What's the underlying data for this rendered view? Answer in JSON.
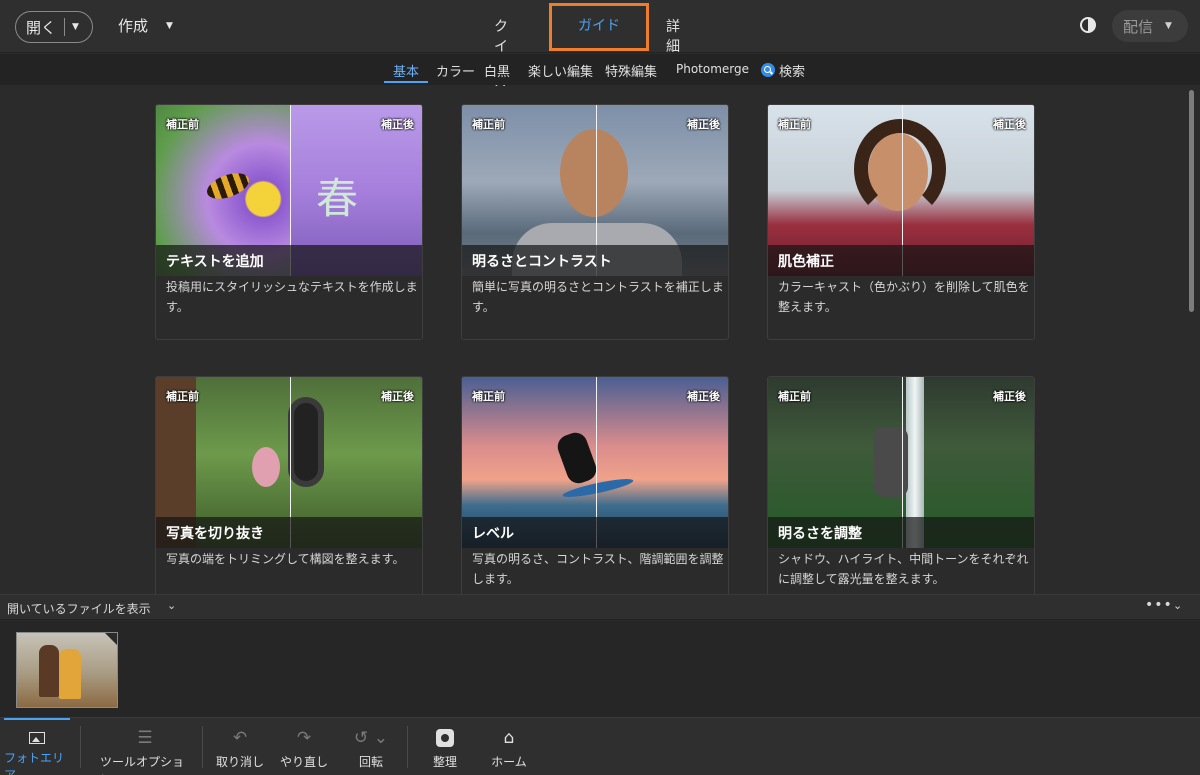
{
  "topbar": {
    "open_label": "開く",
    "create_label": "作成",
    "modes": [
      "クイック",
      "ガイド",
      "詳細"
    ],
    "active_mode": "ガイド",
    "share_label": "配信"
  },
  "categories": {
    "tabs": [
      "基本",
      "カラー",
      "白黒",
      "楽しい編集",
      "特殊編集",
      "Photomerge"
    ],
    "active": "基本",
    "search_label": "検索"
  },
  "cards": [
    {
      "before": "補正前",
      "after": "補正後",
      "title": "テキストを追加",
      "desc": "投稿用にスタイリッシュなテキストを作成します。",
      "overlay_text": "春"
    },
    {
      "before": "補正前",
      "after": "補正後",
      "title": "明るさとコントラスト",
      "desc": "簡単に写真の明るさとコントラストを補正します。"
    },
    {
      "before": "補正前",
      "after": "補正後",
      "title": "肌色補正",
      "desc": "カラーキャスト（色かぶり）を削除して肌色を整えます。"
    },
    {
      "before": "補正前",
      "after": "補正後",
      "title": "写真を切り抜き",
      "desc": "写真の端をトリミングして構図を整えます。"
    },
    {
      "before": "補正前",
      "after": "補正後",
      "title": "レベル",
      "desc": "写真の明るさ、コントラスト、階調範囲を調整します。"
    },
    {
      "before": "補正前",
      "after": "補正後",
      "title": "明るさを調整",
      "desc": "シャドウ、ハイライト、中間トーンをそれぞれに調整して露光量を整えます。"
    }
  ],
  "files": {
    "label": "開いているファイルを表示",
    "more": "•••"
  },
  "bottombar": {
    "photo_area": "フォトエリア",
    "tool_options": "ツールオプション",
    "undo": "取り消し",
    "redo": "やり直し",
    "rotate": "回転",
    "organize": "整理",
    "home": "ホーム"
  },
  "colors": {
    "accent": "#4aa3f5",
    "highlight_box": "#ee7e2c",
    "background": "#2b2b2b"
  }
}
